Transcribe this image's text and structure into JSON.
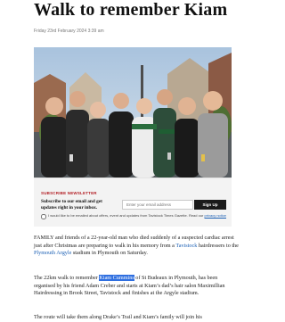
{
  "article": {
    "headline": "Walk to remember Kiam",
    "dateline": "Friday 23rd February 2024 3:39 am",
    "photo": {
      "description_icon": "group-photo"
    }
  },
  "newsletter": {
    "heading": "SUBSCRIBE NEWSLETTER",
    "lead": "Subscribe to our email and get updates right in your inbox.",
    "email_placeholder": "Enter your email address",
    "signup_label": "Sign Up",
    "consent_text": "I would like to be emailed about offers, event and updates from Tavistock Times Gazette. Read our",
    "privacy_link": "privacy notice"
  },
  "paragraphs": {
    "p1": {
      "t1": "FAMILY and friends of a 22-year-old man who died suddenly of a suspected cardiac arrest just after Christmas are preparing to walk in his memory from a ",
      "link1": "Tavistock",
      "t2": " hairdressers to the ",
      "link2": "Plymouth Argyle",
      "t3": " stadium in Plymouth on Saturday."
    },
    "p2": {
      "t1": "The 22km walk to remember ",
      "highlight": "Kiam Cummins",
      "t2": " of St Budeaux in Plymouth, has been organised by his friend Adam Creber and starts at Kiam’s dad’s hair salon Maximillian Hairdressing in Brook Street, Tavistock and finishes at the Argyle stadium."
    },
    "p3": {
      "t1": "The route will take them along Drake’s Trail and Kiam’s family will join his"
    }
  },
  "colors": {
    "accent_red": "#b31f25",
    "link_blue": "#1a5fb4",
    "highlight_blue": "#2f6fe0"
  }
}
